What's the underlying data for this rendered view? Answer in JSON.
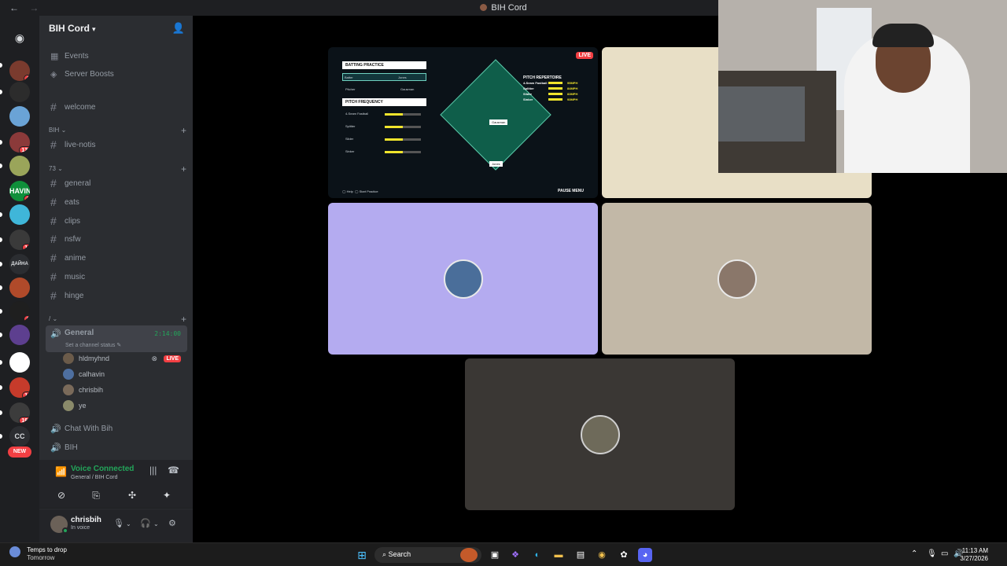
{
  "window": {
    "title": "BIH Cord",
    "back": "←",
    "forward": "→"
  },
  "server": {
    "name": "BIH Cord"
  },
  "servers": [
    {
      "label": "",
      "color": "#5865f2",
      "icon": "discord"
    },
    {
      "label": "",
      "color": "#7a3b2e",
      "badge": "1"
    },
    {
      "label": "",
      "color": "#2c2c2c"
    },
    {
      "label": "",
      "color": "#6aa3d6"
    },
    {
      "label": "",
      "color": "#8b3a3a",
      "badge": "139"
    },
    {
      "label": "",
      "color": "#9aa55a"
    },
    {
      "label": "HAVIN",
      "color": "#0f8f3a",
      "badge": "3"
    },
    {
      "label": "",
      "color": "#3fb6d9"
    },
    {
      "label": "",
      "color": "#3a3a3a",
      "badge": "19"
    },
    {
      "label": "ДАЙНА",
      "color": "#2b2d31"
    },
    {
      "label": "",
      "color": "#b04a2a"
    },
    {
      "label": "",
      "color": "#1f1f1f",
      "badge": "9"
    },
    {
      "label": "",
      "color": "#5d3f8f"
    },
    {
      "label": "",
      "color": "#ffffff"
    },
    {
      "label": "",
      "color": "#c63b2b",
      "badge": "16"
    },
    {
      "label": "",
      "color": "#3c3c3c",
      "badge": "161"
    },
    {
      "label": "CC",
      "color": "#2b2d31"
    },
    {
      "label": "NEW",
      "color": "#f23f43"
    }
  ],
  "channels": {
    "top": [
      {
        "label": "Events",
        "icon": "calendar"
      },
      {
        "label": "Server Boosts",
        "icon": "boost"
      }
    ],
    "welcome": "welcome",
    "cat_bih": "BIH",
    "live_notis": "live-notis",
    "cat_73": "73",
    "text": [
      "general",
      "eats",
      "clips",
      "nsfw",
      "anime",
      "music",
      "hinge"
    ],
    "cat_slash": "/",
    "voice_active": {
      "name": "General",
      "time": "2:14:00",
      "status": "Set a channel status"
    },
    "members": [
      {
        "name": "hldmyhnd",
        "live": "LIVE",
        "color": "#6b5b4a"
      },
      {
        "name": "calhavin",
        "color": "#4e6fa0"
      },
      {
        "name": "chrisbih",
        "color": "#7a6a5a"
      },
      {
        "name": "ye",
        "color": "#8a8a6a"
      }
    ],
    "voice_more": [
      "Chat With Bih",
      "BIH"
    ]
  },
  "voice": {
    "connected": "Voice Connected",
    "sub": "General / BIH Cord"
  },
  "user": {
    "name": "chrisbih",
    "status": "In voice"
  },
  "stream": {
    "live": "LIVE",
    "batting": "BATTING PRACTICE",
    "batter_label": "Batter",
    "batter_value": "Jones",
    "pitcher_label": "Pitcher",
    "pitcher_value": "Gausman",
    "freq": "PITCH FREQUENCY",
    "pitches": [
      {
        "name": "4-Seam Fastball",
        "level": 0.5
      },
      {
        "name": "Splitter",
        "level": 0.5
      },
      {
        "name": "Slider",
        "level": 0.5
      },
      {
        "name": "Sinker",
        "level": 0.5
      }
    ],
    "repertoire": "PITCH REPERTOIRE",
    "rep_items": [
      "4-Seam Fastball",
      "Splitter",
      "Slider",
      "Sinker"
    ],
    "rep_speeds": [
      "95MPH",
      "84MPH",
      "83MPH",
      "93MPH"
    ],
    "field_pitcher": "Gausman",
    "field_batter": "Jones",
    "help": "Help",
    "start": "Start Practice",
    "pause": "PAUSE MENU"
  },
  "tiles": {
    "colors": {
      "beige": "#e8dfc6",
      "purple": "#b4abf0",
      "taupe": "#c2b8a7",
      "dark": "#3a3734"
    }
  },
  "taskbar": {
    "weather_title": "Temps to drop",
    "weather_sub": "Tomorrow",
    "search": "Search",
    "time": "11:13 AM",
    "date": "3/27/2026"
  }
}
